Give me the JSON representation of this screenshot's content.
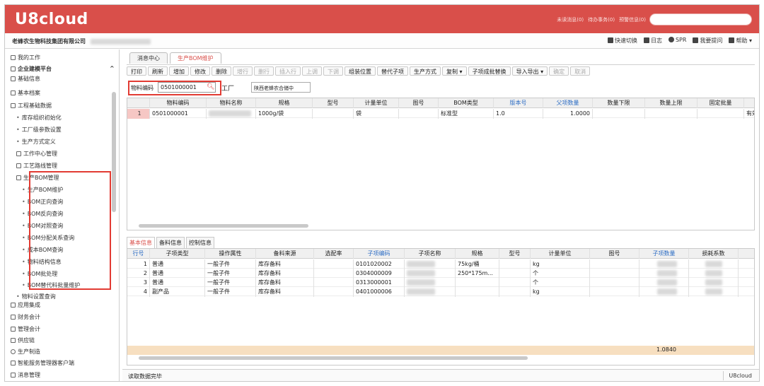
{
  "header": {
    "logo": "U8cloud",
    "links": [
      "未读消息(0)",
      "待办事务(0)",
      "预警信息(0)"
    ]
  },
  "subbar": {
    "company": "老蜂农生物科技集团有限公司",
    "menu": [
      "快速切换",
      "日志",
      "SPR",
      "我要提问",
      "帮助"
    ]
  },
  "sidebar": {
    "items": [
      "我的工作",
      "企业建模平台",
      "基础信息",
      "基本档案",
      "工程基础数据",
      "库存组织初始化",
      "工厂级参数设置",
      "生产方式定义",
      "工作中心管理",
      "工艺路线管理",
      "生产BOM管理",
      "生产BOM维护",
      "BOM正向查询",
      "BOM反向查询",
      "BOM对照查询",
      "BOM分配关系查询",
      "成本BOM查询",
      "物料结构信息",
      "BOM批处理",
      "BOM替代料批量维护",
      "物料设置查询",
      "应用集成",
      "财务会计",
      "管理会计",
      "供应链",
      "生产制造",
      "智能服务管理器客户端",
      "消息管理"
    ]
  },
  "tabs": [
    "消息中心",
    "生产BOM维护"
  ],
  "toolbar": [
    "打印",
    "刷新",
    "增加",
    "修改",
    "删除",
    "增行",
    "删行",
    "插入行",
    "上调",
    "下调",
    "组装位置",
    "替代子项",
    "生产方式",
    "复制 ▾",
    "子项成批替换",
    "导入导出 ▾",
    "确定",
    "取消"
  ],
  "filter": {
    "material_label": "物料编码",
    "material_value": "0501000001",
    "factory_label": "工厂",
    "factory_value": "陕西老蜂农合储中"
  },
  "top_grid": {
    "headers": [
      "物料编码",
      "物料名称",
      "规格",
      "型号",
      "计量单位",
      "图号",
      "BOM类型",
      "版本号",
      "父项数量",
      "数量下限",
      "数量上限",
      "固定批量"
    ],
    "rows": [
      {
        "num": "1",
        "code": "0501000001",
        "spec": "1000g/袋",
        "unit": "袋",
        "bomtype": "标准型",
        "version": "1.0",
        "qty": "1.0000",
        "extra": "有效"
      }
    ]
  },
  "bottom_tabs": [
    "基本信息",
    "备料信息",
    "控制信息"
  ],
  "bottom_grid": {
    "headers": [
      "行号",
      "子项类型",
      "操作属性",
      "备料来源",
      "选配率",
      "子项编码",
      "子项名称",
      "规格",
      "型号",
      "计量单位",
      "图号",
      "子项数量",
      "损耗系数"
    ],
    "rows": [
      {
        "num": "1",
        "type": "普通",
        "attr": "一般子件",
        "source": "库存备料",
        "code": "0101020002",
        "spec": "75kg/桶",
        "unit": "kg"
      },
      {
        "num": "2",
        "type": "普通",
        "attr": "一般子件",
        "source": "库存备料",
        "code": "0304000009",
        "spec": "250*175m...",
        "unit": "个"
      },
      {
        "num": "3",
        "type": "普通",
        "attr": "一般子件",
        "source": "库存备料",
        "code": "0313000001",
        "spec": "",
        "unit": "个"
      },
      {
        "num": "4",
        "type": "副产品",
        "attr": "一般子件",
        "source": "库存备料",
        "code": "0401000006",
        "spec": "",
        "unit": "kg"
      }
    ],
    "sum": "1.0840"
  },
  "status": {
    "text": "读取数据完毕",
    "brand": "U8cloud"
  }
}
